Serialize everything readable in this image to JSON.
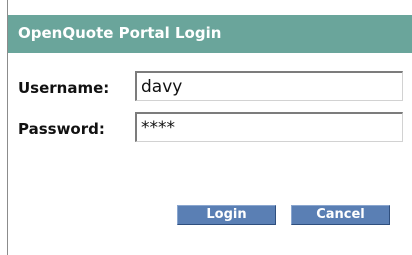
{
  "window": {
    "title": "OpenQuote Portal Login"
  },
  "form": {
    "username": {
      "label": "Username:",
      "value": "davy"
    },
    "password": {
      "label": "Password:",
      "value": "****"
    }
  },
  "buttons": {
    "login_label": "Login",
    "cancel_label": "Cancel"
  },
  "colors": {
    "titlebar": "#6aa59b",
    "button": "#5a7fb4"
  }
}
